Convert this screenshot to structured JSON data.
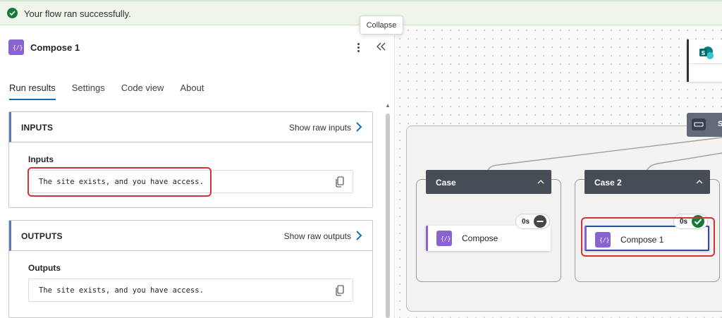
{
  "banner": {
    "message": "Your flow ran successfully."
  },
  "tooltip": {
    "text": "Collapse"
  },
  "panel": {
    "title": "Compose 1",
    "tabs": [
      "Run results",
      "Settings",
      "Code view",
      "About"
    ],
    "active_tab": "Run results",
    "inputs": {
      "header": "INPUTS",
      "raw_link": "Show raw inputs",
      "field_label": "Inputs",
      "value": "The site exists, and you have access."
    },
    "outputs": {
      "header": "OUTPUTS",
      "raw_link": "Show raw outputs",
      "field_label": "Outputs",
      "value": "The site exists, and you have access."
    }
  },
  "canvas": {
    "switch_label": "S",
    "cases": [
      {
        "name": "Case",
        "action": "Compose",
        "duration": "0s",
        "status": "skipped"
      },
      {
        "name": "Case 2",
        "action": "Compose 1",
        "duration": "0s",
        "status": "succeeded"
      }
    ]
  },
  "colors": {
    "accent": "#0f6cbd",
    "compose_purple": "#8a63d2",
    "success": "#137a37",
    "highlight_red": "#d13438",
    "case_header": "#474d56"
  }
}
